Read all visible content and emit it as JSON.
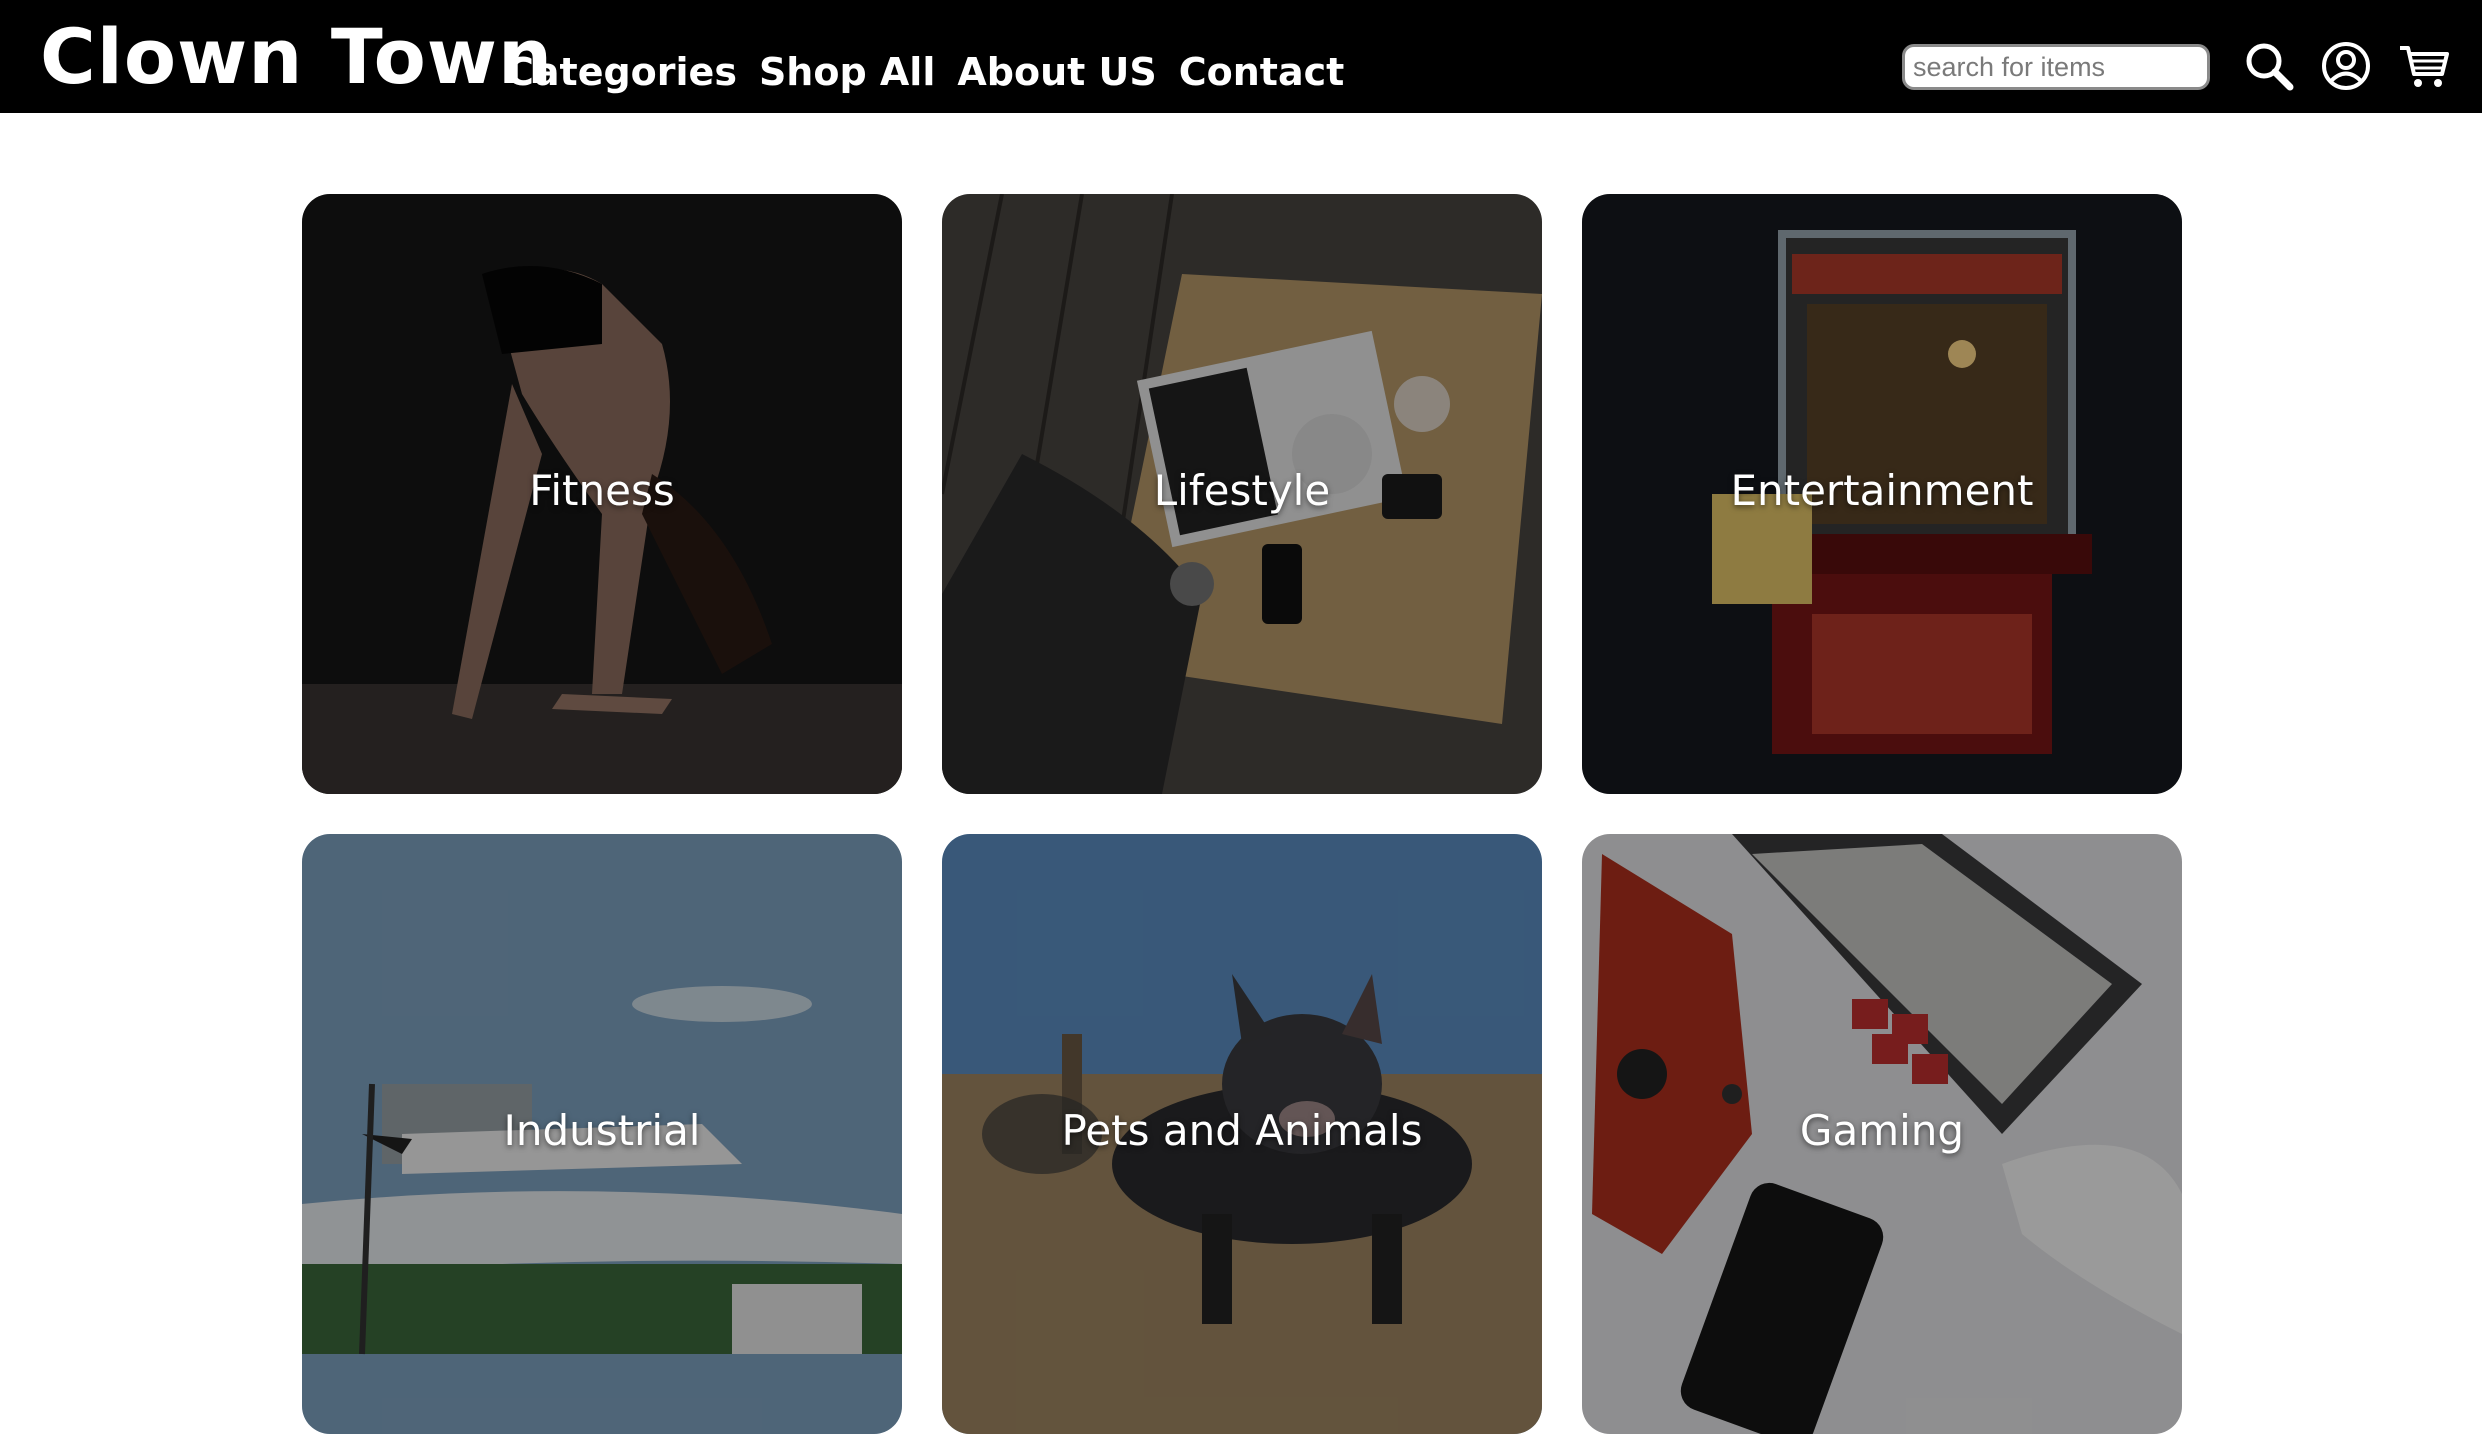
{
  "header": {
    "brand": "Clown Town",
    "nav": [
      "Categories",
      "Shop All",
      "About US",
      "Contact"
    ],
    "search_placeholder": "search for items",
    "icons": [
      "search-icon",
      "account-icon",
      "cart-icon"
    ]
  },
  "categories": [
    "Fitness",
    "Lifestyle",
    "Entertainment",
    "Industrial",
    "Pets and Animals",
    "Gaming"
  ],
  "colors": {
    "header_bg": "#000000",
    "page_bg": "#ffffff",
    "text_on_dark": "#ffffff"
  }
}
